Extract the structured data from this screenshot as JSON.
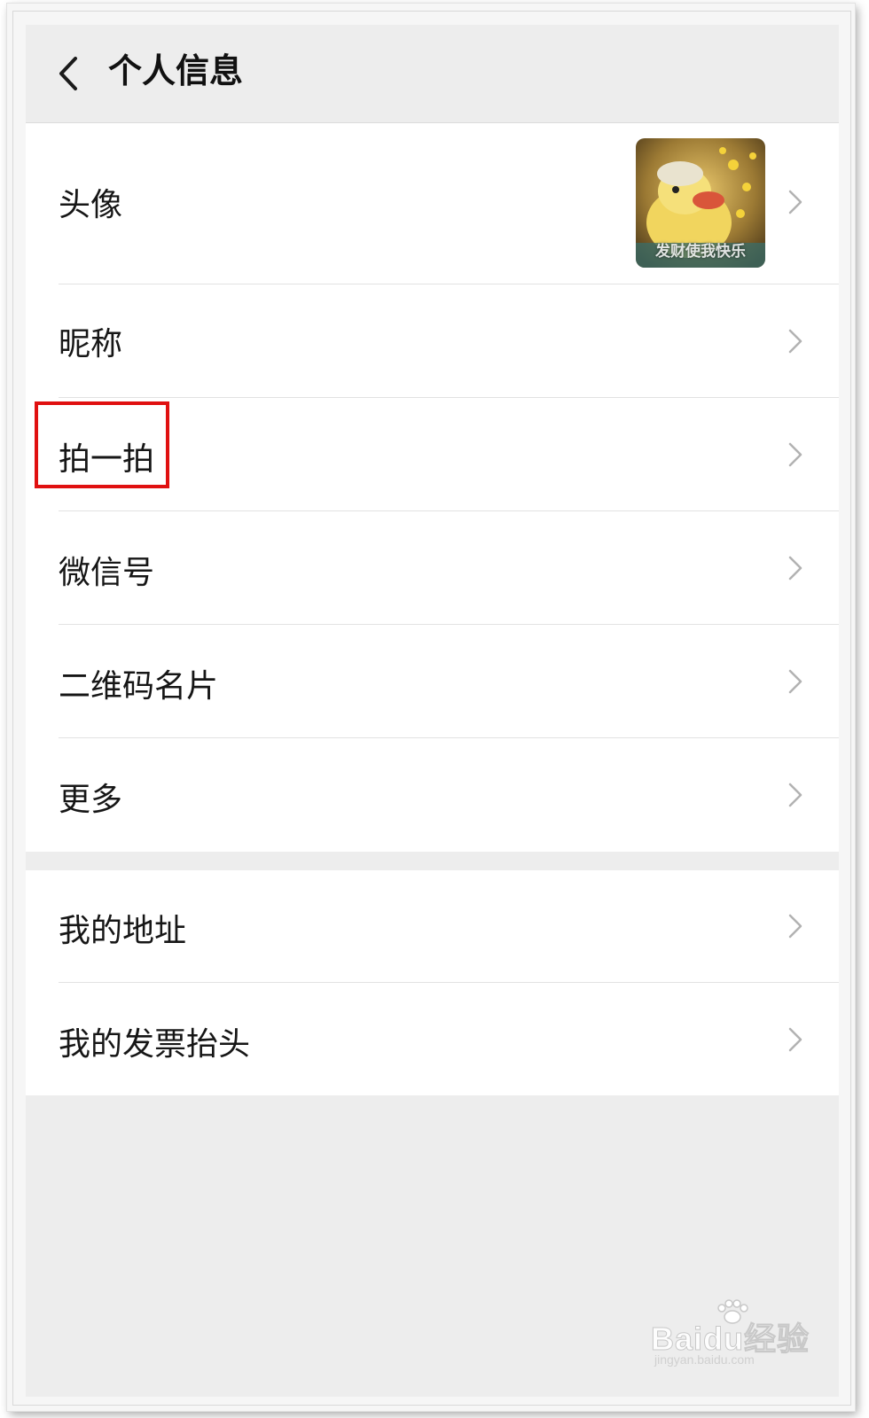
{
  "header": {
    "title": "个人信息",
    "back_icon": "chevron-left-icon"
  },
  "profile": {
    "avatar_label": "头像",
    "avatar_caption": "发财使我快乐",
    "nickname_label": "昵称",
    "pat_label": "拍一拍",
    "wechat_id_label": "微信号",
    "qr_card_label": "二维码名片",
    "more_label": "更多"
  },
  "extra": {
    "address_label": "我的地址",
    "invoice_label": "我的发票抬头"
  },
  "highlight": {
    "target": "拍一拍",
    "color": "#e01010"
  },
  "watermark": {
    "brand": "Baidu经验",
    "url": "jingyan.baidu.com"
  },
  "colors": {
    "background": "#ededed",
    "row_background": "#ffffff",
    "chevron": "#b2b2b2"
  }
}
